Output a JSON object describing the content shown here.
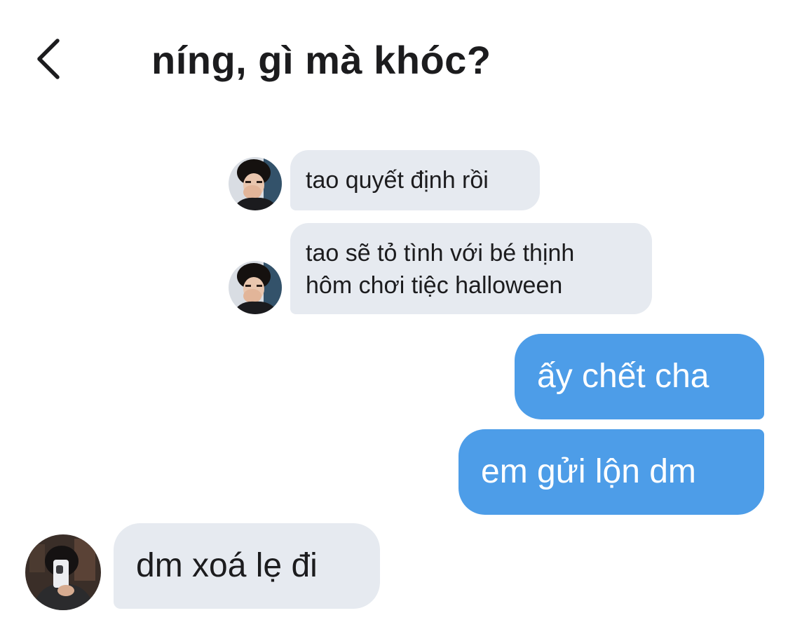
{
  "header": {
    "title": "níng, gì mà khóc?",
    "back_icon": "chevron-left-icon"
  },
  "messages": [
    {
      "side": "incoming",
      "avatar": "avatar-friend-icon",
      "lines": [
        "tao quyết định rồi"
      ]
    },
    {
      "side": "incoming",
      "avatar": "avatar-friend-icon",
      "lines": [
        "tao sẽ tỏ tình với bé thịnh",
        "hôm chơi tiệc halloween"
      ]
    },
    {
      "side": "outgoing",
      "lines": [
        "ấy chết cha"
      ]
    },
    {
      "side": "outgoing",
      "lines": [
        "em gửi lộn dm"
      ]
    },
    {
      "side": "incoming",
      "avatar": "avatar-user-icon",
      "lines": [
        "dm xoá lẹ đi"
      ]
    }
  ],
  "colors": {
    "incoming_bubble": "#e6eaf0",
    "outgoing_bubble": "#4d9de8",
    "text_dark": "#1c1c1e",
    "text_light": "#ffffff"
  }
}
